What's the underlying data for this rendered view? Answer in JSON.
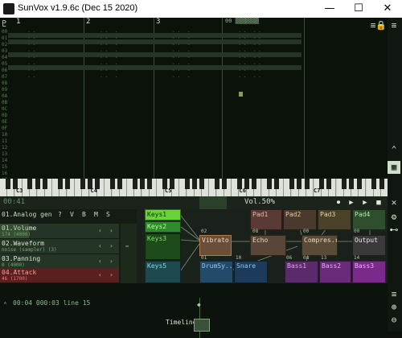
{
  "window": {
    "title": "SunVox v1.9.6c (Dec 15 2020)",
    "minimize_glyph": "—",
    "maximize_glyph": "☐",
    "close_glyph": "✕"
  },
  "pattern": {
    "track_numbers": [
      "1",
      "2",
      "3"
    ],
    "pattern_head": "00 ▒▒▒▒▒▒▒",
    "row_numbers": [
      "00",
      "01",
      "02",
      "03",
      "04",
      "05",
      "06",
      "07",
      "08",
      "09",
      "0A",
      "0B",
      "0C",
      "0D",
      "0E",
      "0F",
      "10",
      "11",
      "12",
      "13",
      "14",
      "15",
      "16",
      "17",
      "18",
      "19",
      "1A",
      "1B",
      "1C",
      "1D",
      "1E",
      "1F"
    ]
  },
  "keyboard": {
    "octaves": [
      "C3",
      "C4",
      "C5",
      "C6",
      "C7"
    ]
  },
  "transport": {
    "time": "00:41",
    "volume": "Vol.50%"
  },
  "module_props": {
    "name": "01.Analog gen",
    "header_buttons": [
      "?",
      "V",
      "B",
      "M",
      "S"
    ],
    "params": [
      {
        "label": "01.Volume",
        "value": "174 (4000)"
      },
      {
        "label": "02.Waveform",
        "value": "noise (sampler) (3)"
      },
      {
        "label": "03.Panning",
        "value": "0 (4000)"
      },
      {
        "label": "04.Attack",
        "value": "46 (1700)"
      }
    ]
  },
  "modules": {
    "keys1": "Keys1",
    "keys2": "Keys2",
    "keys3": "Keys3",
    "keys5": "Keys5",
    "pad1": "Pad1",
    "pad2": "Pad2",
    "pad3": "Pad3",
    "pad4": "Pad4",
    "vibrato": "Vibrato",
    "echo": "Echo",
    "compressor": "Compres.r",
    "output": "Output",
    "drumsynth": "DrumSy..h",
    "snare": "Snare",
    "bass1": "Bass1",
    "bass2": "Bass2",
    "bass3": "Bass3",
    "num_02": "02",
    "num_08": "08",
    "num_00a": "00",
    "num_00b": "00",
    "num_01": "01",
    "num_0a": "0A",
    "num_06": "06",
    "num_10": "10",
    "num_13": "13",
    "num_14": "14"
  },
  "timeline": {
    "status": "00:04 000:03 line 15",
    "label": "Timeline:"
  }
}
